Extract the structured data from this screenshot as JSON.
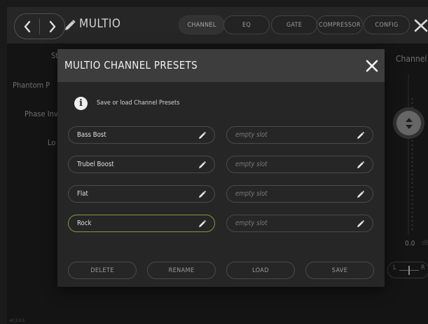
{
  "app": {
    "title": "MULTIO",
    "version": "v0.3.0.5",
    "tabs": [
      {
        "label": "CHANNEL",
        "active": true
      },
      {
        "label": "EQ",
        "active": false
      },
      {
        "label": "GATE",
        "active": false
      },
      {
        "label": "COMPRESSOR",
        "active": false
      },
      {
        "label": "CONFIG",
        "active": false
      }
    ]
  },
  "background": {
    "labels": [
      "St",
      "Phantom P",
      "Phase Inv",
      "Lo"
    ],
    "channel_label": "Channel",
    "fader_value": "0.0",
    "fader_unit": "dB",
    "pan_left": "L",
    "pan_right": "R"
  },
  "modal": {
    "title": "MULTIO CHANNEL PRESETS",
    "info_text": "Save or load Channel Presets",
    "slots": [
      {
        "name": "Bass Bost",
        "empty": false,
        "selected": false
      },
      {
        "name": "empty slot",
        "empty": true,
        "selected": false
      },
      {
        "name": "Trubel Boost",
        "empty": false,
        "selected": false
      },
      {
        "name": "empty slot",
        "empty": true,
        "selected": false
      },
      {
        "name": "Flat",
        "empty": false,
        "selected": false
      },
      {
        "name": "empty slot",
        "empty": true,
        "selected": false
      },
      {
        "name": "Rock",
        "empty": false,
        "selected": true
      },
      {
        "name": "empty slot",
        "empty": true,
        "selected": false
      }
    ],
    "actions": {
      "delete": "DELETE",
      "rename": "RENAME",
      "load": "LOAD",
      "save": "SAVE"
    }
  },
  "colors": {
    "selected_border": "#7f9a3c",
    "header_bg": "#3d3d3d",
    "modal_bg": "#262626"
  }
}
